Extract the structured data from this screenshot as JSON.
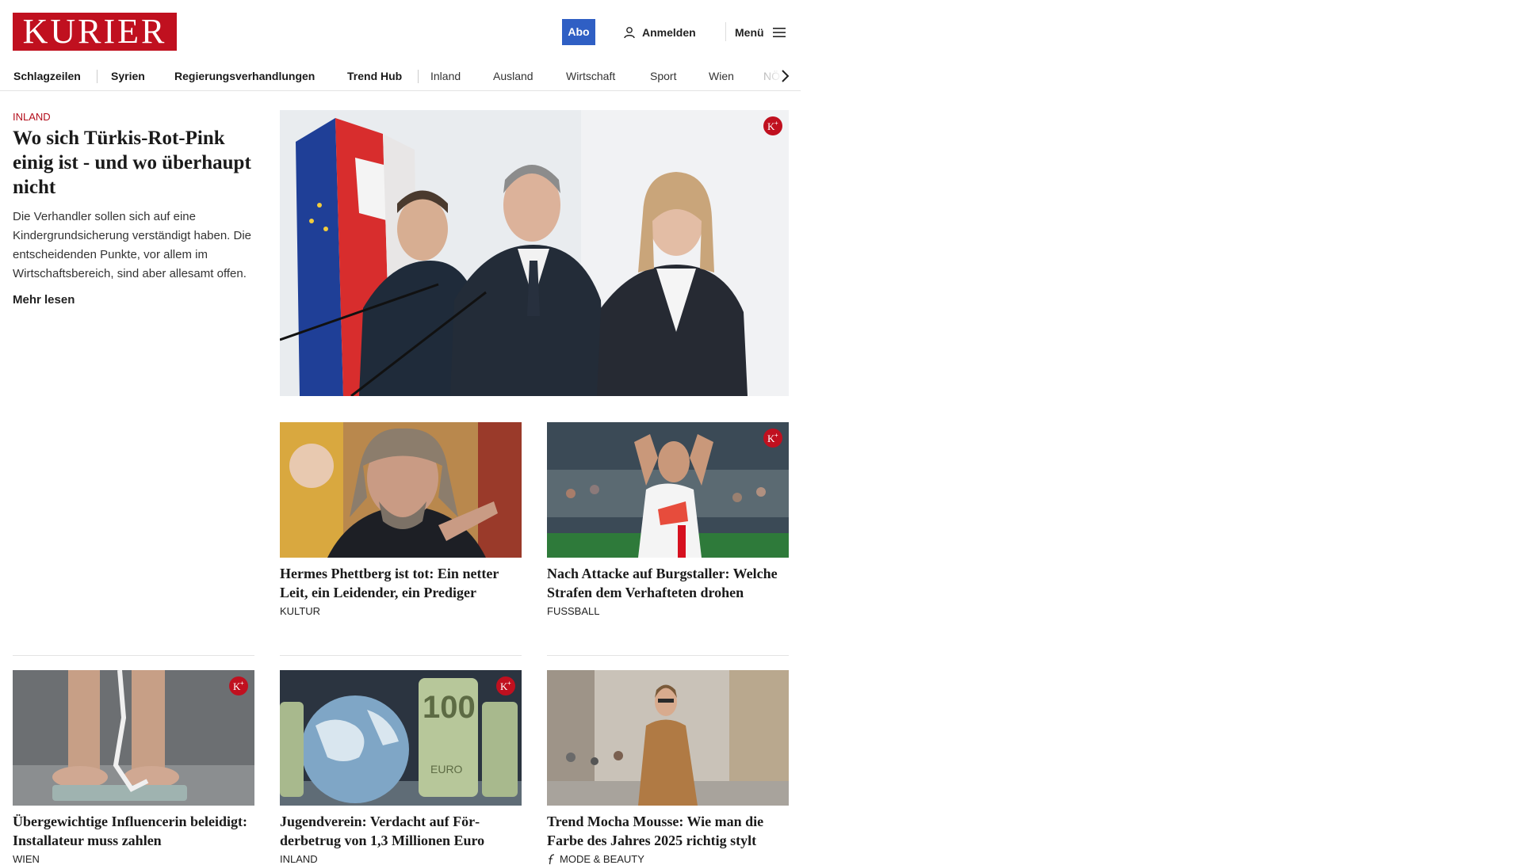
{
  "header": {
    "logo": "KURIER",
    "abo_label": "Abo",
    "login_label": "Anmelden",
    "menu_label": "Menü"
  },
  "nav": {
    "items": [
      "Schlagzeilen",
      "Syrien",
      "Regierungsverhandlungen",
      "Trend Hub",
      "Inland",
      "Ausland",
      "Wirtschaft",
      "Sport",
      "Wien",
      "NÖ"
    ]
  },
  "hero": {
    "kicker": "INLAND",
    "title": "Wo sich Türkis-Rot-Pink einig ist - und wo über­haupt nicht",
    "teaser": "Die Verhandler sollen sich auf eine Kindergrundsicherung verständigt haben. Die entscheidenden Punkte, vor allem im Wirtschaftsbereich, sind aber allesamt offen.",
    "more": "Mehr lesen"
  },
  "cards": [
    {
      "title": "Hermes Phettberg ist tot: Ein netter Leit, ein Leidender, ein Prediger",
      "category": "KULTUR"
    },
    {
      "title": "Nach Attacke auf Burgstaller: Wel­che Strafen dem Verhafteten drohen",
      "category": "FUSSBALL"
    },
    {
      "title": "Übergewichtige Influencerin belei­digt: Installateur muss zahlen",
      "category": "WIEN"
    },
    {
      "title": "Jugendverein: Verdacht auf För­derbetrug von 1,3 Millionen Euro",
      "category": "INLAND"
    },
    {
      "title": "Trend Mocha Mousse: Wie man die Farbe des Jahres 2025 richtig stylt",
      "category": "MODE & BEAUTY"
    }
  ],
  "badge": {
    "label": "K+"
  },
  "colors": {
    "brand": "#c0101f",
    "abo": "#2f5fc4",
    "kicker": "#b30d1b"
  }
}
